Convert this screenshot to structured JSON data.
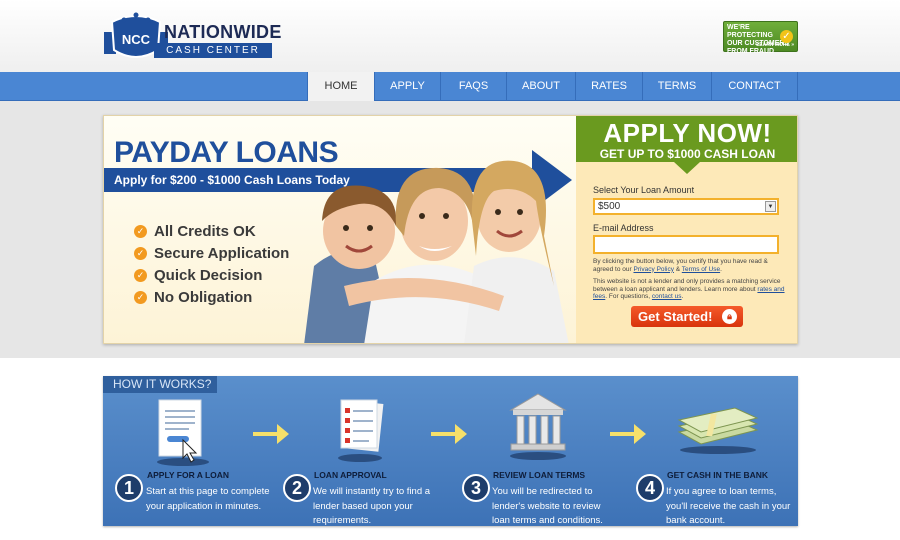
{
  "brand": {
    "logo_initials": "NCC",
    "name": "NATIONWIDE",
    "subtitle": "CASH CENTER"
  },
  "fraud_badge": {
    "lines": [
      "WE'RE PROTECTING",
      "OUR CUSTOMERS",
      "FROM FRAUD"
    ],
    "learn_more": "LEARN MORE »"
  },
  "nav": {
    "items": [
      {
        "label": "HOME",
        "active": true
      },
      {
        "label": "APPLY",
        "active": false
      },
      {
        "label": "FAQS",
        "active": false
      },
      {
        "label": "ABOUT",
        "active": false
      },
      {
        "label": "RATES",
        "active": false
      },
      {
        "label": "TERMS",
        "active": false
      },
      {
        "label": "CONTACT",
        "active": false
      }
    ]
  },
  "hero": {
    "title": "PAYDAY LOANS",
    "subtitle": "Apply for $200 - $1000 Cash Loans Today",
    "benefits": [
      "All Credits OK",
      "Secure Application",
      "Quick Decision",
      "No Obligation"
    ]
  },
  "apply": {
    "heading": "APPLY NOW!",
    "tagline": "GET UP TO $1000 CASH LOAN",
    "amount_label": "Select Your Loan Amount",
    "amount_value": "$500",
    "email_label": "E-mail Address",
    "email_value": "",
    "fine_print_1": {
      "before": "By clicking the button below, you certify that you have read & agreed to our ",
      "link1": "Privacy Policy",
      "middle": " & ",
      "link2": "Terms of Use",
      "after": "."
    },
    "fine_print_2": {
      "before": "This website is not a lender and only provides a matching service between a loan applicant and lenders. Learn more about ",
      "link1": "rates and fees",
      "middle": ". For questions, ",
      "link2": "contact us",
      "after": "."
    },
    "cta_label": "Get Started!"
  },
  "how_it_works": {
    "tab_label": "HOW IT WORKS?",
    "steps": [
      {
        "number": "1",
        "title": "APPLY FOR A LOAN",
        "description": "Start at this page to complete your application in minutes."
      },
      {
        "number": "2",
        "title": "LOAN APPROVAL",
        "description": "We will instantly try to find a lender based upon your requirements."
      },
      {
        "number": "3",
        "title": "REVIEW LOAN TERMS",
        "description": "You will be redirected to lender's website to review loan terms and conditions."
      },
      {
        "number": "4",
        "title": "GET CASH IN THE BANK",
        "description": "If you agree to loan terms, you'll receive the cash in your bank account."
      }
    ]
  },
  "colors": {
    "nav_blue": "#4a86d3",
    "brand_navy": "#1f4f9c",
    "apply_green": "#6a9a1f",
    "accent_orange": "#f29a20",
    "cta_red": "#e5471a"
  }
}
